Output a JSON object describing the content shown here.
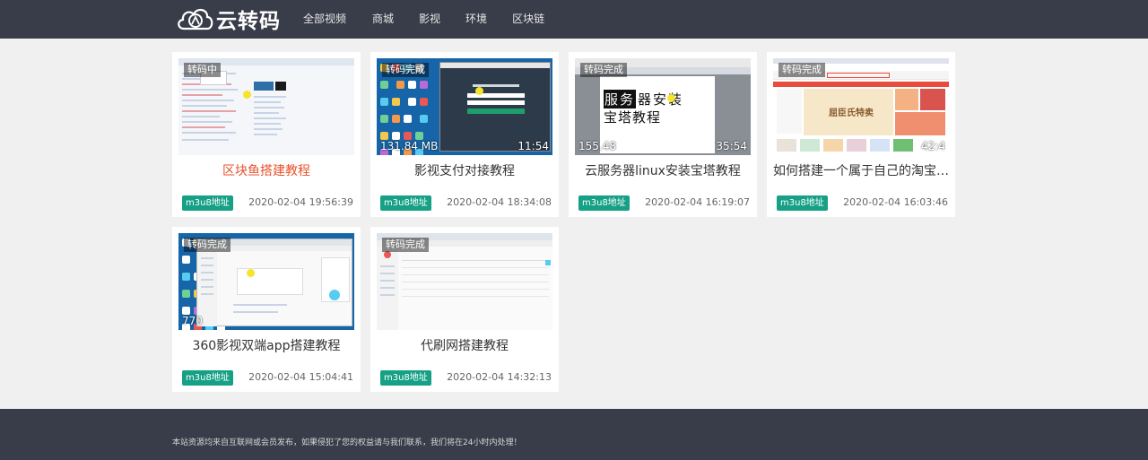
{
  "brand": {
    "name": "云转码"
  },
  "nav": [
    "全部视频",
    "商城",
    "影视",
    "环境",
    "区块链"
  ],
  "cards": [
    {
      "status": "转码中",
      "title": "区块鱼搭建教程",
      "tag": "m3u8地址",
      "date": "2020-02-04 19:56:39",
      "size": "",
      "duration": "",
      "active": true,
      "thumb": "browser",
      "thumb_text": []
    },
    {
      "status": "转码完成",
      "title": "影视支付对接教程",
      "tag": "m3u8地址",
      "date": "2020-02-04 18:34:08",
      "size": "131.84 MB",
      "duration": "11:54",
      "active": false,
      "thumb": "login",
      "thumb_text": []
    },
    {
      "status": "转码完成",
      "title": "云服务器linux安装宝塔教程",
      "tag": "m3u8地址",
      "date": "2020-02-04 16:19:07",
      "size": "155.48",
      "duration": "35:54",
      "active": false,
      "thumb": "slide",
      "thumb_text": [
        "服务",
        "器安装",
        "宝塔教程"
      ]
    },
    {
      "status": "转码完成",
      "title": "如何搭建一个属于自己的淘宝客...",
      "tag": "m3u8地址",
      "date": "2020-02-04 16:03:46",
      "size": "",
      "duration": "42:4",
      "active": false,
      "thumb": "shop",
      "thumb_text": [
        "屈臣氏特卖"
      ]
    },
    {
      "status": "转码完成",
      "title": "360影视双端app搭建教程",
      "tag": "m3u8地址",
      "date": "2020-02-04 15:04:41",
      "size": "770",
      "duration": "",
      "active": false,
      "thumb": "admin",
      "thumb_text": []
    },
    {
      "status": "转码完成",
      "title": "代刷网搭建教程",
      "tag": "m3u8地址",
      "date": "2020-02-04 14:32:13",
      "size": "",
      "duration": "",
      "active": false,
      "thumb": "table",
      "thumb_text": []
    }
  ],
  "footer": {
    "notice": "本站资源均来自互联网或会员发布，如果侵犯了您的权益请与我们联系，我们将在24小时内处理！"
  },
  "colors": {
    "topbar": "#393d49",
    "tag": "#16a085",
    "active_title": "#e8522b",
    "background": "#f0f0f0"
  }
}
